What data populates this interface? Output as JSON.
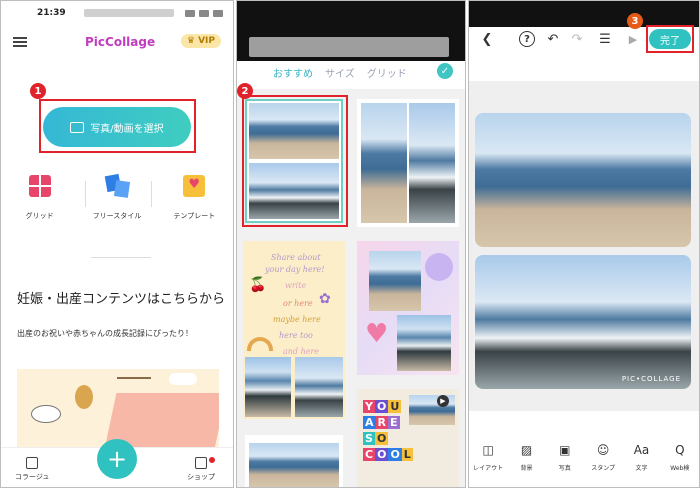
{
  "panel1": {
    "status_time": "21:39",
    "logo": "PicCollage",
    "vip_label": "VIP",
    "select_button_label": "写真/動画を選択",
    "step_badge": "1",
    "modes": [
      {
        "label": "グリッド",
        "icon": "grid-icon"
      },
      {
        "label": "フリースタイル",
        "icon": "freestyle-icon"
      },
      {
        "label": "テンプレート",
        "icon": "template-icon"
      }
    ],
    "promo_title": "妊娠・出産コンテンツはこちらから",
    "promo_subtitle": "出産のお祝いや赤ちゃんの成長記録にぴったり！",
    "nav": {
      "left_label": "コラージュ",
      "right_label": "ショップ",
      "fab_symbol": "+"
    },
    "colors": {
      "accent": "#2fc2c0",
      "highlight": "#e0232b",
      "logo": "#c23cbf"
    }
  },
  "panel2": {
    "step_badge": "2",
    "tabs": [
      "おすすめ",
      "サイズ",
      "グリッド"
    ],
    "active_tab": "おすすめ",
    "template_text": {
      "line1": "Share about",
      "line2": "your day here!",
      "line3": "write",
      "line4": "or here",
      "line5": "maybe here",
      "line6": "here too",
      "line7": "and here"
    },
    "letter_tiles": [
      "Y",
      "O",
      "U",
      "A",
      "R",
      "E",
      "S",
      "O",
      "C",
      "O",
      "O",
      "L"
    ]
  },
  "panel3": {
    "step_badge": "3",
    "done_label": "完了",
    "help_symbol": "?",
    "watermark": "PIC•COLLAGE",
    "tools": [
      {
        "label": "レイアウト",
        "icon": "layout-icon",
        "glyph": "◫"
      },
      {
        "label": "背景",
        "icon": "background-icon",
        "glyph": "▨"
      },
      {
        "label": "写真",
        "icon": "photo-icon",
        "glyph": "▣"
      },
      {
        "label": "スタンプ",
        "icon": "sticker-icon",
        "glyph": "☺"
      },
      {
        "label": "文字",
        "icon": "text-icon",
        "glyph": "Aa"
      },
      {
        "label": "Web検",
        "icon": "web-search-icon",
        "glyph": "Q"
      }
    ]
  }
}
